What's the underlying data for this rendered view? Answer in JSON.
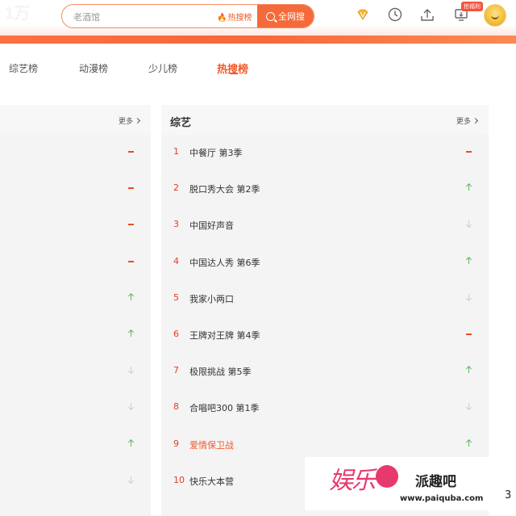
{
  "header": {
    "logo": "1万",
    "search_placeholder": "老酒馆",
    "hot_link": "热搜榜",
    "search_button": "全网搜",
    "badge": "抢福利",
    "icons": [
      "vip-diamond-icon",
      "history-clock-icon",
      "upload-icon",
      "device-download-icon",
      "avatar"
    ]
  },
  "tabs": [
    {
      "label": "综艺榜"
    },
    {
      "label": "动漫榜"
    },
    {
      "label": "少儿榜"
    },
    {
      "label": "热搜榜",
      "active": true
    }
  ],
  "left_panel": {
    "more": "更多",
    "trends": [
      "flat",
      "flat",
      "flat",
      "flat",
      "up",
      "up",
      "down",
      "down",
      "up",
      "down"
    ]
  },
  "right_panel": {
    "title": "综艺",
    "more": "更多",
    "items": [
      {
        "rank": "1",
        "title": "中餐厅 第3季",
        "trend": "flat"
      },
      {
        "rank": "2",
        "title": "脱口秀大会 第2季",
        "trend": "up"
      },
      {
        "rank": "3",
        "title": "中国好声音",
        "trend": "down"
      },
      {
        "rank": "4",
        "title": "中国达人秀 第6季",
        "trend": "up"
      },
      {
        "rank": "5",
        "title": "我家小两口",
        "trend": "down"
      },
      {
        "rank": "6",
        "title": "王牌对王牌 第4季",
        "trend": "flat"
      },
      {
        "rank": "7",
        "title": "极限挑战 第5季",
        "trend": "up"
      },
      {
        "rank": "8",
        "title": "合唱吧300 第1季",
        "trend": "down"
      },
      {
        "rank": "9",
        "title": "爱情保卫战",
        "trend": "up",
        "highlight": true
      },
      {
        "rank": "10",
        "title": "快乐大本营",
        "trend": "down"
      }
    ]
  },
  "watermark": {
    "logo_text": "娱乐",
    "brand": "派趣吧",
    "url": "www.paiquba.com"
  },
  "corner_number": "3",
  "colors": {
    "accent": "#f25a2a",
    "rank": "#e33b2a",
    "up": "#5cb85c",
    "flat": "#ea4b2b",
    "down": "#cfcfcf"
  }
}
